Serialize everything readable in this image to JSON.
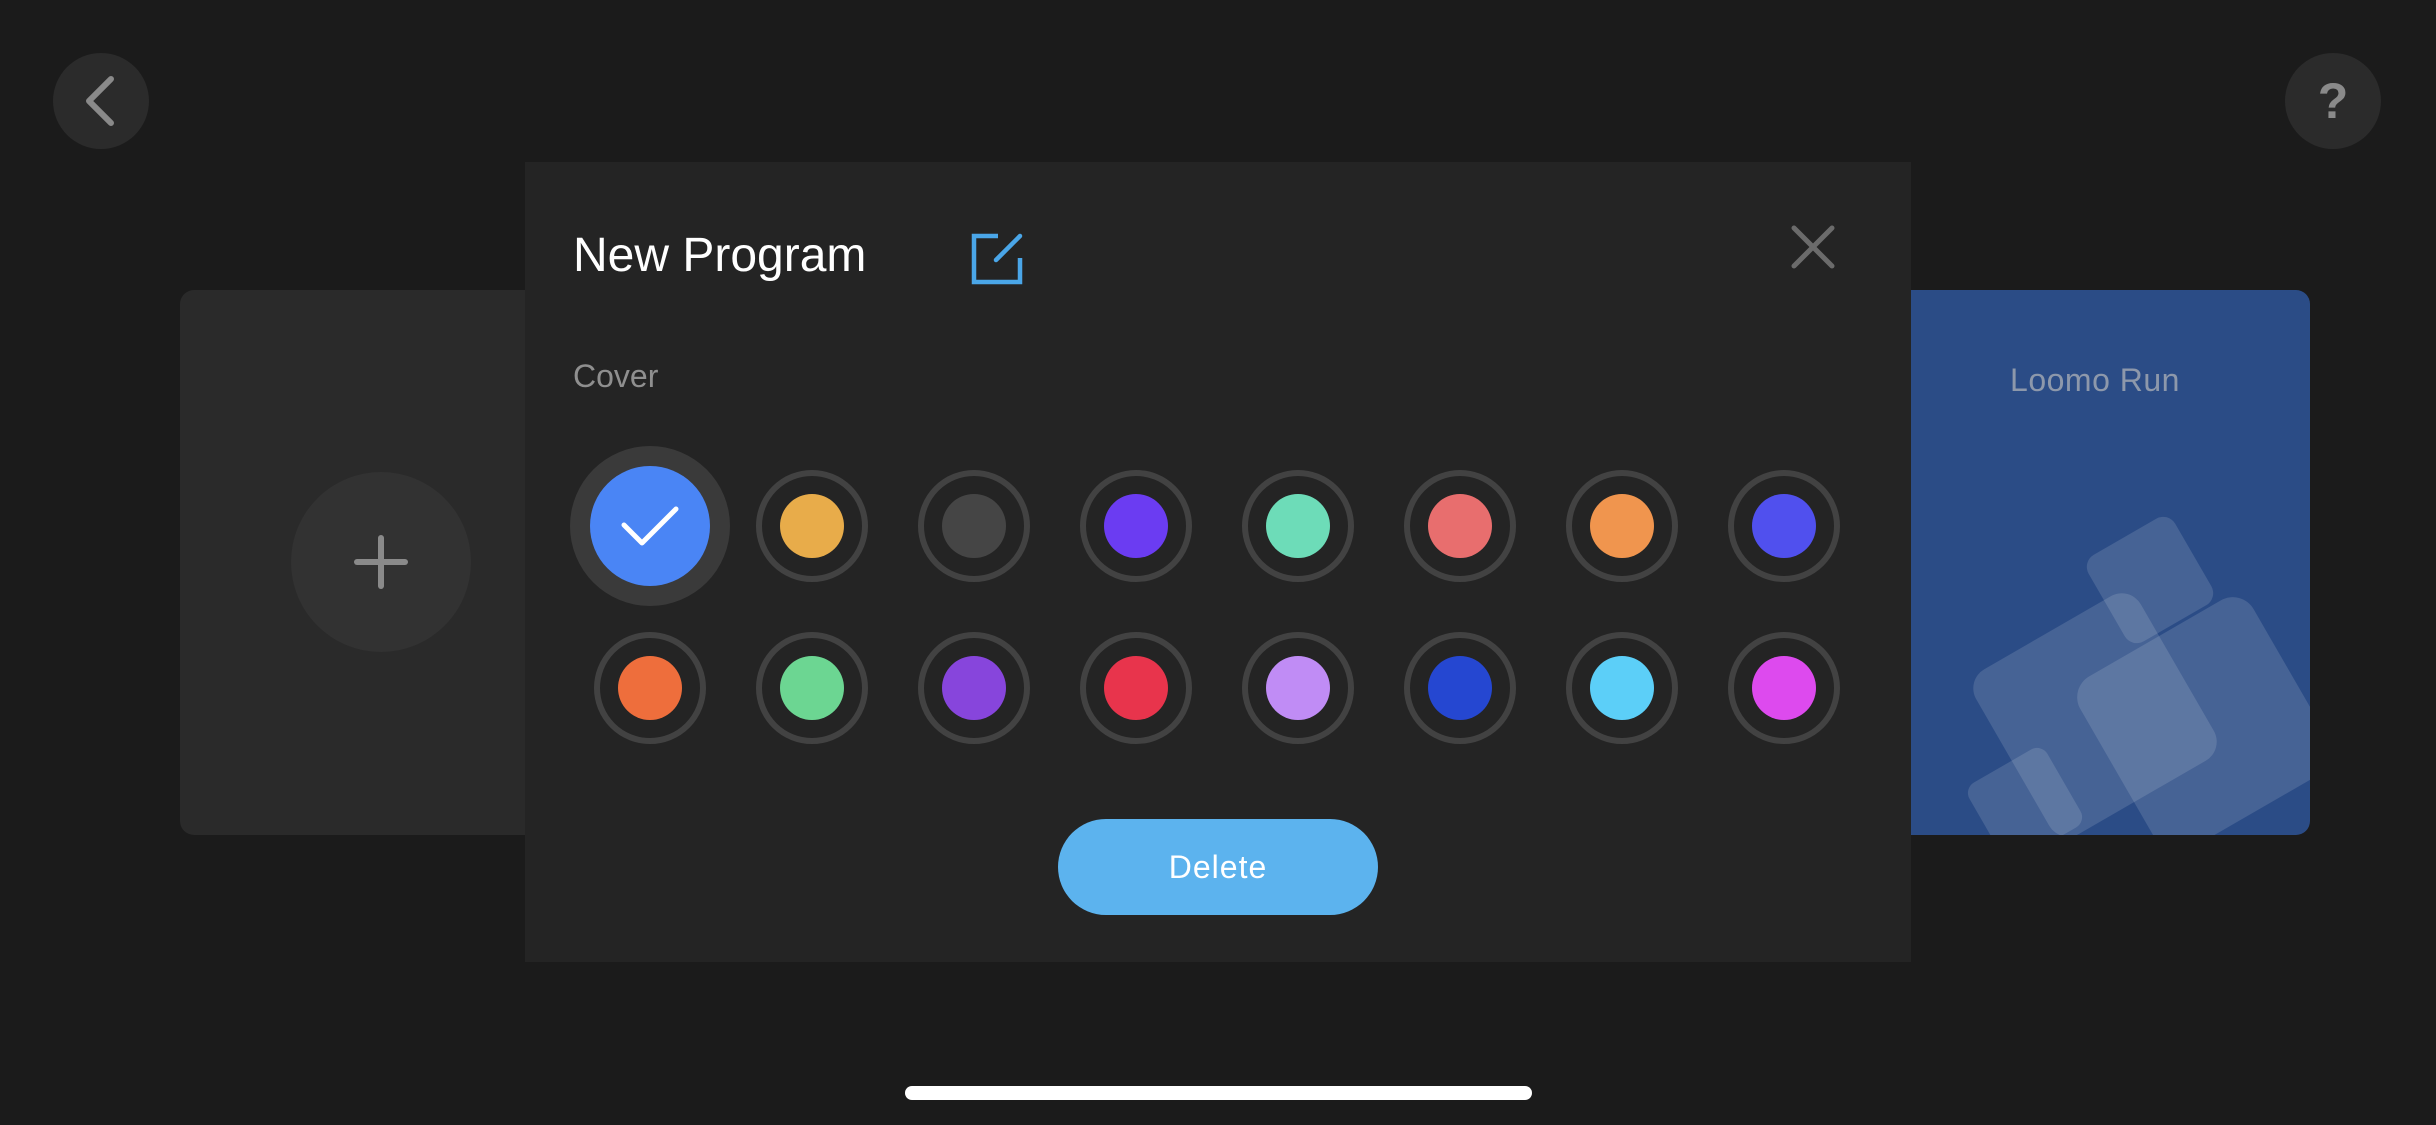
{
  "nav": {
    "back_icon": "chevron-left-icon",
    "help_label": "?"
  },
  "left_card": {
    "add_icon": "plus-icon"
  },
  "right_card": {
    "title": "Loomo Run",
    "background": "#2b4c86"
  },
  "modal": {
    "title": "New Program",
    "edit_icon": "edit-icon",
    "close_icon": "close-icon",
    "cover_label": "Cover",
    "accent": "#5cb3ee",
    "swatches": [
      {
        "color": "#4a85f5",
        "selected": true
      },
      {
        "color": "#e8ac4a",
        "selected": false
      },
      {
        "color": "#454545",
        "selected": false
      },
      {
        "color": "#6b3cf2",
        "selected": false
      },
      {
        "color": "#6ddcb8",
        "selected": false
      },
      {
        "color": "#e86e6e",
        "selected": false
      },
      {
        "color": "#f0954e",
        "selected": false
      },
      {
        "color": "#5050ee",
        "selected": false
      },
      {
        "color": "#ee6e3c",
        "selected": false
      },
      {
        "color": "#6cd692",
        "selected": false
      },
      {
        "color": "#8745dc",
        "selected": false
      },
      {
        "color": "#e8344c",
        "selected": false
      },
      {
        "color": "#c08cf5",
        "selected": false
      },
      {
        "color": "#2547d1",
        "selected": false
      },
      {
        "color": "#5ccff8",
        "selected": false
      },
      {
        "color": "#dd4aee",
        "selected": false
      }
    ],
    "delete_label": "Delete"
  }
}
